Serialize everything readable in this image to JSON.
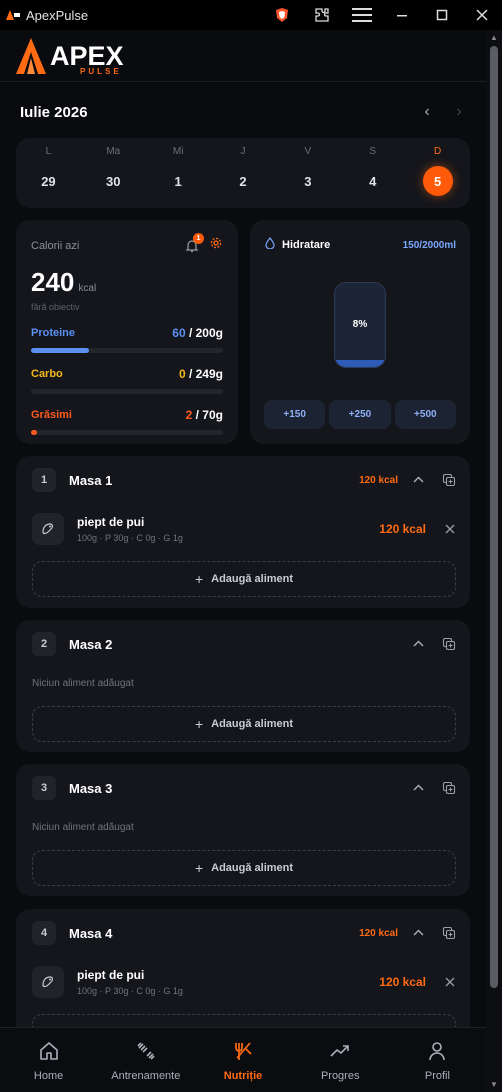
{
  "window": {
    "title": "ApexPulse",
    "logo_text": "APEX"
  },
  "brand": {
    "name": "APEX",
    "sub": "PULSE",
    "accent": "#ff6a13"
  },
  "calendar": {
    "month": "Iulie 2026",
    "days": [
      {
        "letter": "L",
        "num": "29"
      },
      {
        "letter": "Ma",
        "num": "30"
      },
      {
        "letter": "Mi",
        "num": "1"
      },
      {
        "letter": "J",
        "num": "2"
      },
      {
        "letter": "V",
        "num": "3"
      },
      {
        "letter": "S",
        "num": "4"
      },
      {
        "letter": "D",
        "num": "5",
        "active": true
      }
    ]
  },
  "calories": {
    "label": "Calorii azi",
    "value": "240",
    "unit": "kcal",
    "goal": "fără obiectiv",
    "notif_count": "1",
    "macros": [
      {
        "name": "Proteine",
        "current": "60",
        "target": "/ 200g",
        "fraction": 0.3,
        "color": "#5b8ff0"
      },
      {
        "name": "Carbo",
        "current": "0",
        "target": "/ 249g",
        "fraction": 0.0,
        "color": "#f3b81c"
      },
      {
        "name": "Grăsimi",
        "current": "2",
        "target": "/ 70g",
        "fraction": 0.03,
        "color": "#ff5a1f"
      }
    ]
  },
  "hydration": {
    "title": "Hidratare",
    "amount": "150/2000ml",
    "percent_label": "8%",
    "fraction": 0.08,
    "buttons": [
      "+150",
      "+250",
      "+500"
    ]
  },
  "meals": [
    {
      "num": "1",
      "title": "Masa 1",
      "kcal": "120 kcal",
      "foods": [
        {
          "name": "piept de pui",
          "meta": "100g · P 30g · C 0g · G 1g",
          "kcal": "120 kcal"
        }
      ],
      "add_label": "Adaugă aliment"
    },
    {
      "num": "2",
      "title": "Masa 2",
      "kcal": "",
      "empty": "Niciun aliment adăugat",
      "foods": [],
      "add_label": "Adaugă aliment"
    },
    {
      "num": "3",
      "title": "Masa 3",
      "kcal": "",
      "empty": "Niciun aliment adăugat",
      "foods": [],
      "add_label": "Adaugă aliment"
    },
    {
      "num": "4",
      "title": "Masa 4",
      "kcal": "120 kcal",
      "foods": [
        {
          "name": "piept de pui",
          "meta": "100g · P 30g · C 0g · G 1g",
          "kcal": "120 kcal"
        }
      ],
      "add_label": "Adaugă aliment"
    }
  ],
  "nav": [
    {
      "label": "Home",
      "icon": "home-icon"
    },
    {
      "label": "Antrenamente",
      "icon": "dumbbell-icon"
    },
    {
      "label": "Nutriție",
      "icon": "utensils-icon",
      "active": true
    },
    {
      "label": "Progres",
      "icon": "trend-icon"
    },
    {
      "label": "Profil",
      "icon": "user-icon"
    }
  ]
}
